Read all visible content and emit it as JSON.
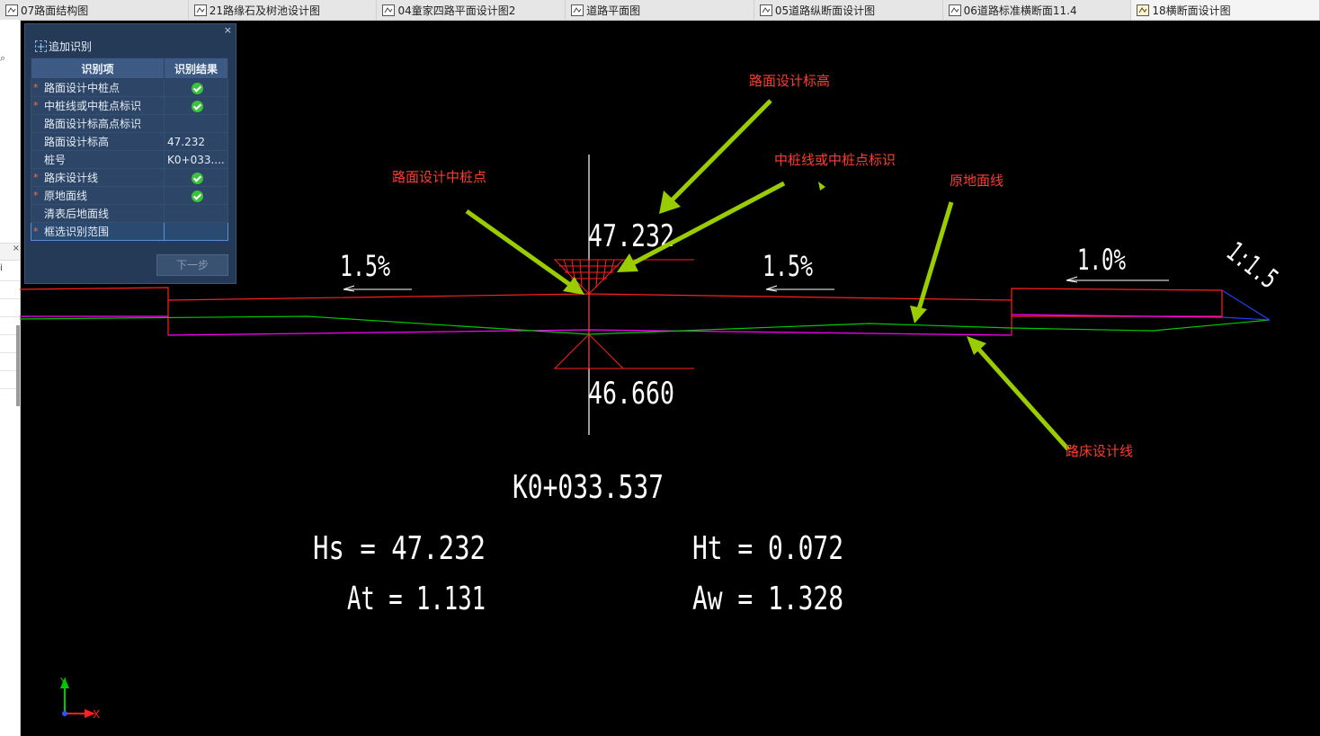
{
  "tabs": [
    {
      "label": "07路面结构图",
      "active": false
    },
    {
      "label": "21路缘石及树池设计图",
      "active": false
    },
    {
      "label": "04童家四路平面设计图2",
      "active": false
    },
    {
      "label": "道路平面图",
      "active": false
    },
    {
      "label": "05道路纵断面设计图",
      "active": false
    },
    {
      "label": "06道路标准横断面11.4",
      "active": false
    },
    {
      "label": "18横断面设计图",
      "active": true
    }
  ],
  "left_strip": {
    "fragment": "i"
  },
  "panel": {
    "add_label": "追加识别",
    "close": "×",
    "header_item": "识别项",
    "header_result": "识别结果",
    "rows": [
      {
        "required": true,
        "label": "路面设计中桩点",
        "result": "",
        "status": "ok"
      },
      {
        "required": true,
        "label": "中桩线或中桩点标识",
        "result": "",
        "status": "ok"
      },
      {
        "required": false,
        "label": "路面设计标高点标识",
        "result": "",
        "status": ""
      },
      {
        "required": false,
        "label": "路面设计标高",
        "result": "47.232",
        "status": ""
      },
      {
        "required": false,
        "label": "桩号",
        "result": "K0+033....",
        "status": ""
      },
      {
        "required": true,
        "label": "路床设计线",
        "result": "",
        "status": "ok"
      },
      {
        "required": true,
        "label": "原地面线",
        "result": "",
        "status": "ok"
      },
      {
        "required": false,
        "label": "清表后地面线",
        "result": "",
        "status": ""
      },
      {
        "required": true,
        "label": "框选识别范围",
        "result": "",
        "status": ""
      }
    ],
    "next_label": "下一步"
  },
  "annotations": {
    "design_elevation": "路面设计标高",
    "center_line": "中桩线或中桩点标识",
    "center_point": "路面设计中桩点",
    "ground_line": "原地面线",
    "subgrade_line": "路床设计线"
  },
  "drawing": {
    "top_elevation": "47.232",
    "bottom_elevation": "46.660",
    "slope_left": "1.5%",
    "slope_mid": "1.5%",
    "slope_right": "1.0%",
    "side_slope": "1:1.5",
    "station": "K0+033.537",
    "hs": "Hs = 47.232",
    "ht": "Ht = 0.072",
    "at": "At = 1.131",
    "aw": "Aw = 1.328",
    "axis_y": "Y",
    "axis_x": "X"
  },
  "colors": {
    "road_surface": "#ff0000",
    "subgrade": "#ff00ff",
    "ground": "#00cc00",
    "slope": "#1e3cff",
    "arrow": "#9acd00",
    "annotation_text": "#ff3b30"
  }
}
